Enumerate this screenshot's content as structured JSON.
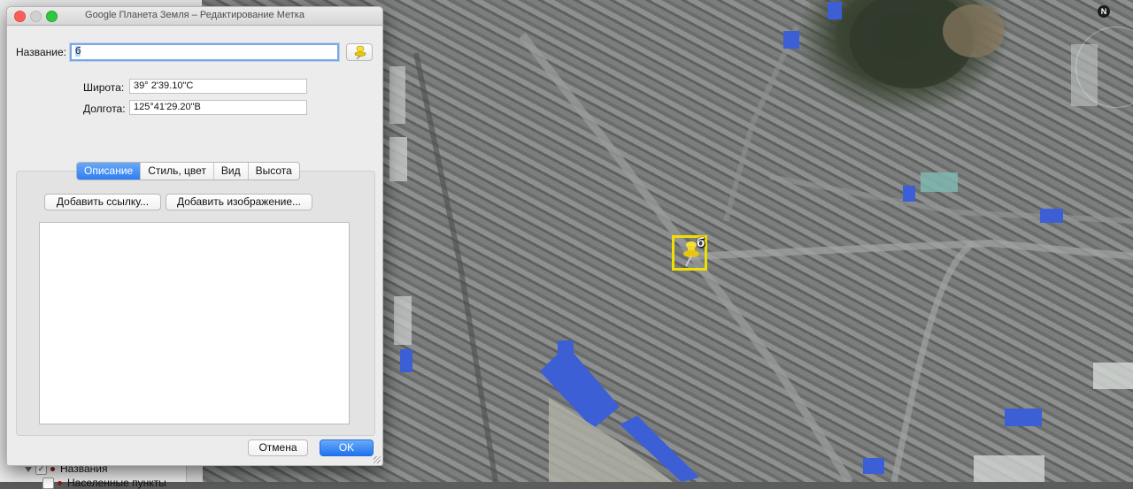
{
  "window": {
    "title": "Google Планета Земля – Редактирование Метка"
  },
  "form": {
    "name_label": "Название:",
    "name_value": "б",
    "latitude_label": "Широта:",
    "latitude_value": "39° 2'39.10\"С",
    "longitude_label": "Долгота:",
    "longitude_value": "125°41'29.20\"В"
  },
  "tabs": [
    {
      "label": "Описание",
      "active": true
    },
    {
      "label": "Стиль, цвет",
      "active": false
    },
    {
      "label": "Вид",
      "active": false
    },
    {
      "label": "Высота",
      "active": false
    }
  ],
  "description_tab": {
    "add_link_label": "Добавить ссылку...",
    "add_image_label": "Добавить изображение..."
  },
  "actions": {
    "cancel_label": "Отмена",
    "ok_label": "OK"
  },
  "places_panel": {
    "items": [
      "Названия",
      "Населенные пункты"
    ]
  },
  "map": {
    "placemark_label": "б",
    "north_label": "N",
    "placemark_color": "#f0e000",
    "roof_color": "#3d5fd6"
  },
  "icons": {
    "pin": "yellow-pushpin-icon",
    "north": "compass-north-icon"
  }
}
